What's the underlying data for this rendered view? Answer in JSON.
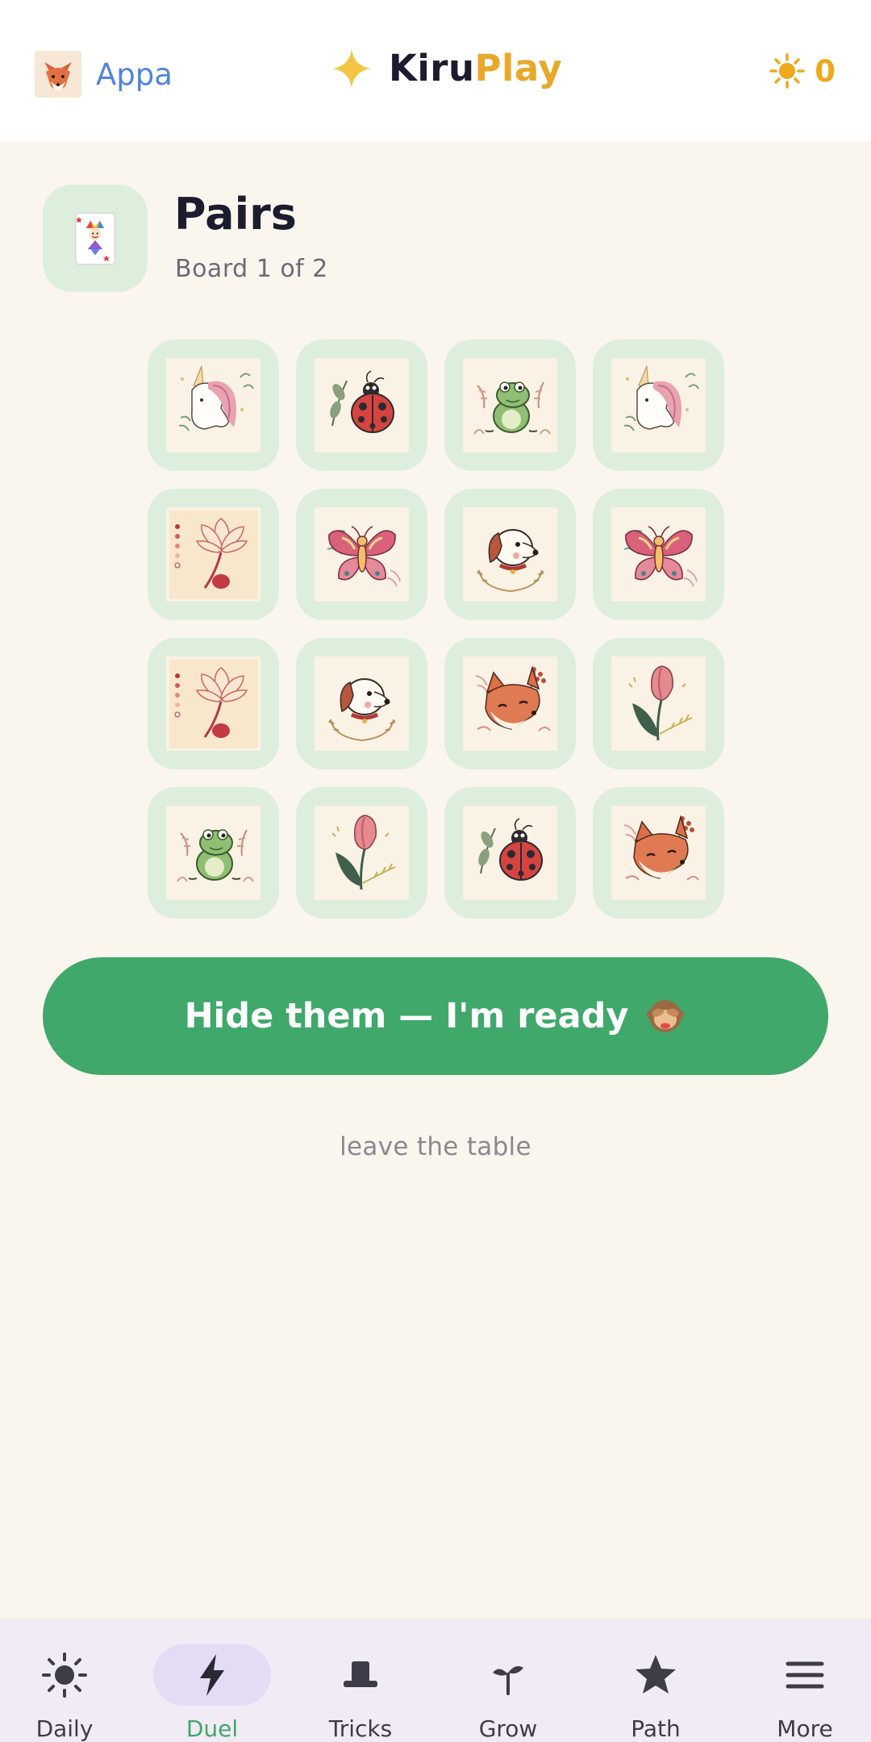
{
  "header": {
    "profile_name": "Appa",
    "brand_part1": "Kiru",
    "brand_part2": "Play",
    "suns_count": "0",
    "icons": {
      "avatar": "fox-avatar-icon",
      "brand": "sparkle-star-icon",
      "suns": "sun-icon"
    },
    "colors": {
      "profile": "#4f86d9",
      "brand_accent": "#e8a92a",
      "suns": "#f0a81d"
    }
  },
  "game": {
    "title": "Pairs",
    "subtitle": "Board 1 of 2",
    "icon": "joker-card-icon"
  },
  "cards": [
    [
      "unicorn",
      "ladybug",
      "frog",
      "unicorn"
    ],
    [
      "lotus",
      "butterfly",
      "puppy",
      "butterfly"
    ],
    [
      "lotus",
      "puppy",
      "fox",
      "tulip"
    ],
    [
      "frog",
      "tulip",
      "ladybug",
      "fox"
    ]
  ],
  "actions": {
    "ready_label": "Hide them — I'm ready",
    "ready_icon": "see-no-evil-monkey-icon",
    "leave_label": "leave the table",
    "ready_color": "#3fa86a"
  },
  "nav": {
    "active": "Duel",
    "items": [
      {
        "label": "Daily",
        "icon": "sun-icon"
      },
      {
        "label": "Duel",
        "icon": "lightning-icon"
      },
      {
        "label": "Tricks",
        "icon": "top-hat-icon"
      },
      {
        "label": "Grow",
        "icon": "sprout-icon"
      },
      {
        "label": "Path",
        "icon": "star-icon"
      },
      {
        "label": "More",
        "icon": "menu-icon"
      }
    ]
  }
}
